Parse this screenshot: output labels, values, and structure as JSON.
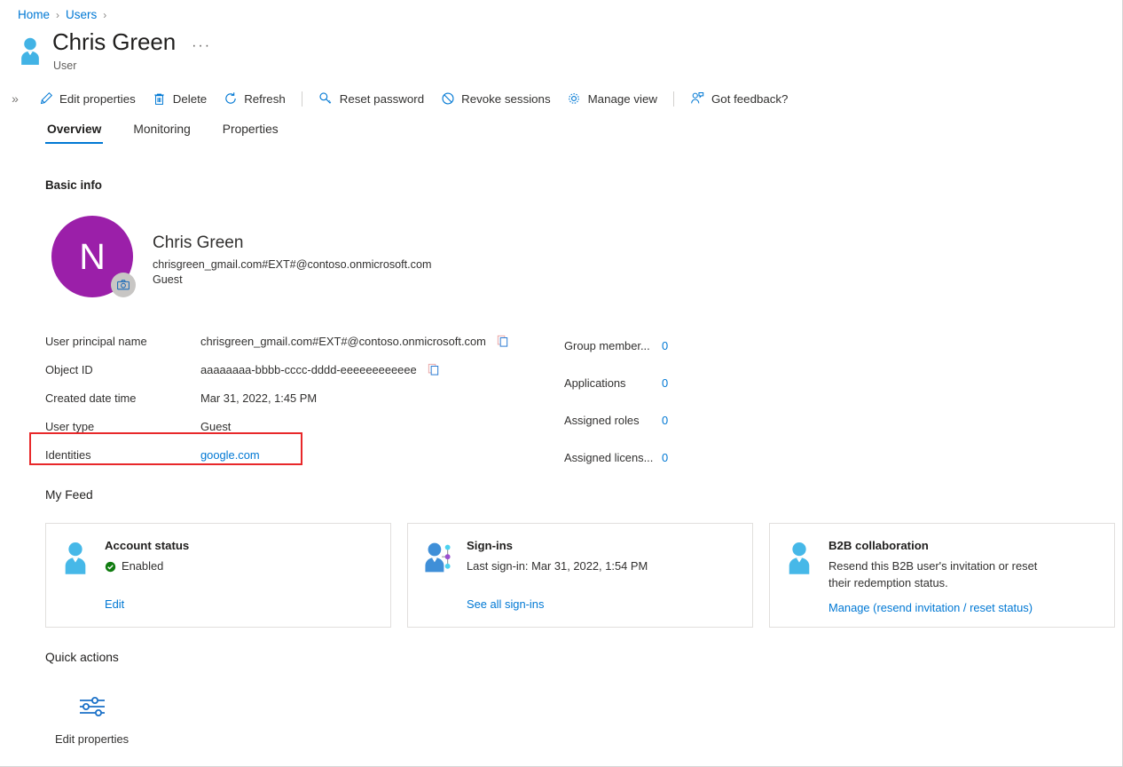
{
  "breadcrumb": {
    "items": [
      "Home",
      "Users"
    ]
  },
  "header": {
    "title": "Chris Green",
    "subtitle": "User",
    "more_label": "···",
    "user_icon": "user-icon"
  },
  "commandbar": {
    "expand_label": "»",
    "items": [
      {
        "label": "Edit properties",
        "icon": "pencil-icon"
      },
      {
        "label": "Delete",
        "icon": "trash-icon"
      },
      {
        "label": "Refresh",
        "icon": "refresh-icon"
      },
      {
        "label": "Reset password",
        "icon": "key-icon"
      },
      {
        "label": "Revoke sessions",
        "icon": "block-icon"
      },
      {
        "label": "Manage view",
        "icon": "gear-icon"
      },
      {
        "label": "Got feedback?",
        "icon": "feedback-icon"
      }
    ]
  },
  "tabs": [
    {
      "label": "Overview",
      "active": true
    },
    {
      "label": "Monitoring",
      "active": false
    },
    {
      "label": "Properties",
      "active": false
    }
  ],
  "sections": {
    "basic_info": "Basic info",
    "my_feed": "My Feed",
    "quick_actions": "Quick actions"
  },
  "identity": {
    "avatar_initial": "N",
    "avatar_color": "#9b1fa9",
    "camera_badge": "camera-icon",
    "name": "Chris Green",
    "upn": "chrisgreen_gmail.com#EXT#@contoso.onmicrosoft.com",
    "user_type": "Guest"
  },
  "properties_left": [
    {
      "key": "User principal name",
      "value": "chrisgreen_gmail.com#EXT#@contoso.onmicrosoft.com",
      "copy": true,
      "link": false
    },
    {
      "key": "Object ID",
      "value": "aaaaaaaa-bbbb-cccc-dddd-eeeeeeeeeeee",
      "copy": true,
      "link": false
    },
    {
      "key": "Created date time",
      "value": "Mar 31, 2022, 1:45 PM",
      "copy": false,
      "link": false
    },
    {
      "key": "User type",
      "value": "Guest",
      "copy": false,
      "link": false
    },
    {
      "key": "Identities",
      "value": "google.com",
      "copy": false,
      "link": true
    }
  ],
  "properties_right": [
    {
      "key": "Group member...",
      "value": "0"
    },
    {
      "key": "Applications",
      "value": "0"
    },
    {
      "key": "Assigned roles",
      "value": "0"
    },
    {
      "key": "Assigned licens...",
      "value": "0"
    }
  ],
  "highlight": {
    "color": "#e8282a",
    "target": "Identities"
  },
  "feed_cards": [
    {
      "icon": "person-icon",
      "title": "Account status",
      "status_icon": "check-circle-icon",
      "status_color": "#107c10",
      "subtitle": "Enabled",
      "link": "Edit"
    },
    {
      "icon": "person-signin-icon",
      "title": "Sign-ins",
      "subtitle": "Last sign-in: Mar 31, 2022, 1:54 PM",
      "link": "See all sign-ins"
    },
    {
      "icon": "person-icon",
      "title": "B2B collaboration",
      "subtitle": "Resend this B2B user's invitation or reset their redemption status.",
      "link": "Manage (resend invitation / reset status)"
    }
  ],
  "quick_action": {
    "icon": "sliders-icon",
    "label": "Edit properties"
  },
  "colors": {
    "accent": "#0078d4",
    "link": "#0078d4",
    "success": "#107c10",
    "highlight": "#e8282a",
    "avatar": "#9b1fa9"
  }
}
